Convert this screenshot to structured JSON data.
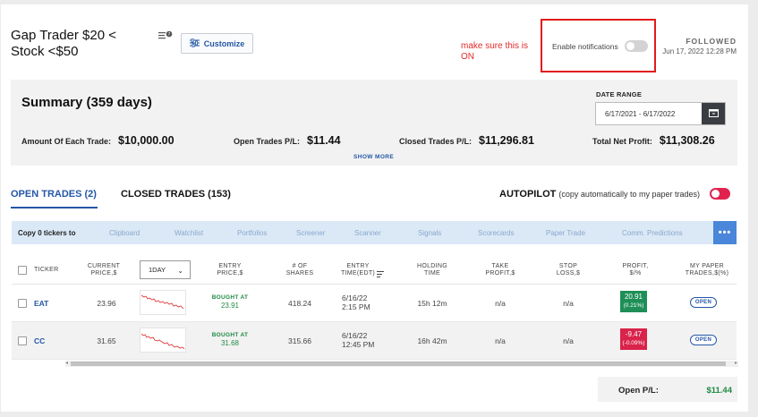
{
  "header": {
    "title": "Gap Trader $20 < Stock <$50",
    "customize_label": "Customize",
    "annotation": "make sure this is ON",
    "notifications_label": "Enable notifications",
    "followed_label": "FOLLOWED",
    "followed_date": "Jun 17, 2022 12:28 PM"
  },
  "summary": {
    "title": "Summary (359 days)",
    "date_range_label": "DATE RANGE",
    "date_range_value": "6/17/2021 - 6/17/2022",
    "amount_label": "Amount Of Each Trade:",
    "amount_value": "$10,000.00",
    "open_pl_label": "Open Trades P/L:",
    "open_pl_value": "$11.44",
    "closed_pl_label": "Closed Trades P/L:",
    "closed_pl_value": "$11,296.81",
    "total_label": "Total Net Profit:",
    "total_value": "$11,308.26",
    "show_more": "SHOW MORE"
  },
  "tabs": {
    "open": "OPEN TRADES (2)",
    "closed": "CLOSED TRADES (153)",
    "autopilot": "AUTOPILOT",
    "autopilot_note": "(copy automatically to my paper trades)"
  },
  "copybar": {
    "label": "Copy 0 tickers to",
    "links": [
      "Clipboard",
      "Watchlist",
      "Portfolios",
      "Screener",
      "Scanner",
      "Signals",
      "Scorecards",
      "Paper Trade",
      "Comm. Predictions"
    ],
    "more": "•••"
  },
  "table": {
    "headers": {
      "ticker": "TICKER",
      "current_price": "CURRENT\nPRICE,$",
      "period": "1DAY",
      "entry_price": "ENTRY\nPRICE,$",
      "shares": "# OF\nSHARES",
      "entry_time": "ENTRY\nTIME(EDT)",
      "holding": "HOLDING\nTIME",
      "take_profit": "TAKE\nPROFIT,$",
      "stop_loss": "STOP\nLOSS,$",
      "profit": "PROFIT,\n$/%",
      "paper": "MY PAPER\nTRADES,$(%)"
    },
    "rows": [
      {
        "ticker": "EAT",
        "current_price": "23.96",
        "bought_label": "BOUGHT AT",
        "entry_price": "23.91",
        "shares": "418.24",
        "entry_date": "6/16/22",
        "entry_time": "2:15 PM",
        "holding": "15h 12m",
        "take_profit": "n/a",
        "stop_loss": "n/a",
        "profit": "20.91",
        "profit_pct": "(0.21%)",
        "paper": "OPEN",
        "profit_color": "#1e8f57"
      },
      {
        "ticker": "CC",
        "current_price": "31.65",
        "bought_label": "BOUGHT AT",
        "entry_price": "31.68",
        "shares": "315.66",
        "entry_date": "6/16/22",
        "entry_time": "12:45 PM",
        "holding": "16h 42m",
        "take_profit": "n/a",
        "stop_loss": "n/a",
        "profit": "-9.47",
        "profit_pct": "(-0.09%)",
        "paper": "OPEN",
        "profit_color": "#d9234b"
      }
    ]
  },
  "footer": {
    "open_pl_label": "Open P/L:",
    "open_pl_value": "$11.44"
  },
  "colors": {
    "accent": "#2457a6",
    "positive": "#1f8a43",
    "negative": "#d9234b",
    "annotation": "#e02a2a"
  }
}
